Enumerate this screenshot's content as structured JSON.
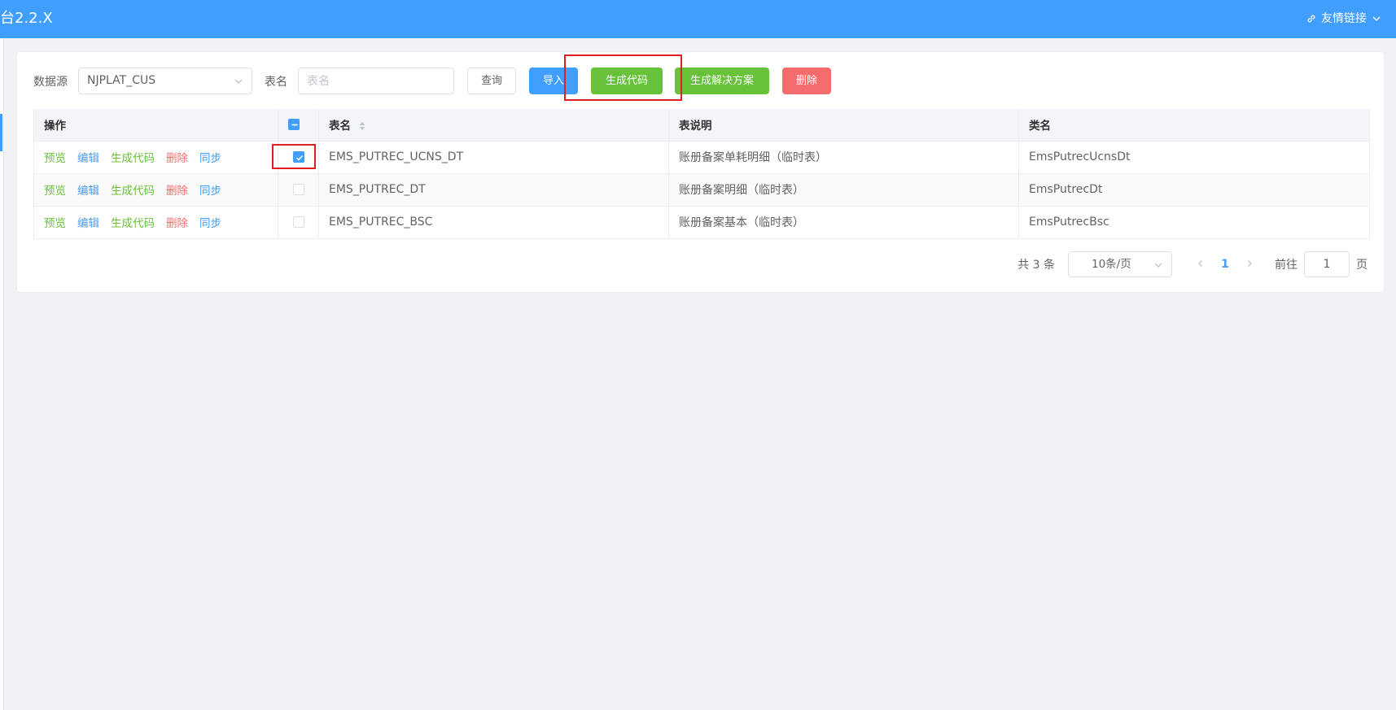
{
  "header": {
    "title": "台2.2.X",
    "links_label": "友情链接"
  },
  "toolbar": {
    "datasource_label": "数据源",
    "datasource_value": "NJPLAT_CUS",
    "tablename_label": "表名",
    "tablename_placeholder": "表名",
    "query_label": "查询",
    "import_label": "导入",
    "generate_label": "生成代码",
    "solution_label": "生成解决方案",
    "delete_label": "删除"
  },
  "table": {
    "headers": {
      "actions": "操作",
      "name": "表名",
      "comment": "表说明",
      "class": "类名"
    },
    "actions": {
      "preview": "预览",
      "edit": "编辑",
      "generate": "生成代码",
      "delete": "删除",
      "sync": "同步"
    },
    "rows": [
      {
        "name": "EMS_PUTREC_UCNS_DT",
        "comment": "账册备案单耗明细（临时表）",
        "class": "EmsPutrecUcnsDt",
        "checked": true
      },
      {
        "name": "EMS_PUTREC_DT",
        "comment": "账册备案明细（临时表）",
        "class": "EmsPutrecDt",
        "checked": false
      },
      {
        "name": "EMS_PUTREC_BSC",
        "comment": "账册备案基本（临时表）",
        "class": "EmsPutrecBsc",
        "checked": false
      }
    ]
  },
  "pagination": {
    "total": "共 3 条",
    "page_size": "10条/页",
    "current_page": "1",
    "goto_label": "前往",
    "goto_value": "1",
    "page_suffix": "页"
  },
  "colors": {
    "primary": "#409eff",
    "success": "#67c23a",
    "danger": "#f56c6c",
    "highlight": "#e02020"
  }
}
